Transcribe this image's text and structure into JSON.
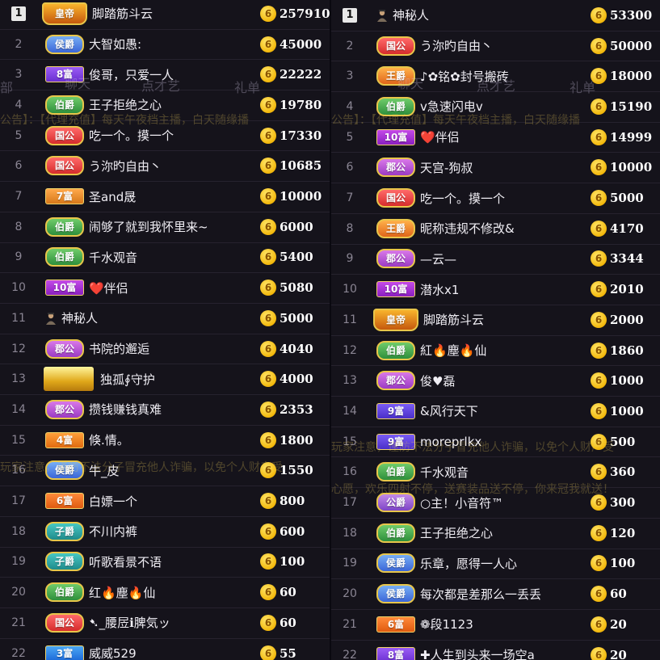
{
  "colors": {
    "background": "#15131b",
    "coin": "#f3b80c",
    "text": "#f0eef4",
    "rank": "#8a8593"
  },
  "icons": {
    "coin": "coin-icon",
    "mystery": "mystery-person-icon",
    "guardian": "guardian-crown-icon"
  },
  "overlay": {
    "tabs": [
      "聊天",
      "点才艺",
      "礼单"
    ],
    "left_edge": "部",
    "announcement_1": "公告】：【代理充值】每天午夜档主播，白天随缘播",
    "announcement_2": "玩家注意，谨防不法分子冒充他人诈骗，以免个人财产受",
    "announcement_3": "心愿，欢乐四射不停，送赛装品送不停，你来冠我就送！"
  },
  "left": [
    {
      "rank": "1",
      "badge": "皇帝",
      "type": "huangdi",
      "name": "脚踏筋斗云",
      "amount": "257910"
    },
    {
      "rank": "2",
      "badge": "侯爵",
      "type": "hou",
      "name": "大智如愚:",
      "amount": "45000"
    },
    {
      "rank": "3",
      "badge": "8富",
      "type": "fu8",
      "name": "俊哥，只爱一人",
      "amount": "22222"
    },
    {
      "rank": "4",
      "badge": "伯爵",
      "type": "bo",
      "name": "王子拒绝之心",
      "amount": "19780"
    },
    {
      "rank": "5",
      "badge": "国公",
      "type": "gong",
      "name": "吃一个。摸一个",
      "amount": "17330"
    },
    {
      "rank": "6",
      "badge": "国公",
      "type": "gong",
      "name": "う沵旳自由丶",
      "amount": "10685"
    },
    {
      "rank": "7",
      "badge": "7富",
      "type": "fu7",
      "name": "圣and晟",
      "amount": "10000"
    },
    {
      "rank": "8",
      "badge": "伯爵",
      "type": "bo",
      "name": "闹够了就到我怀里来~",
      "amount": "6000"
    },
    {
      "rank": "9",
      "badge": "伯爵",
      "type": "bo",
      "name": "千水观音",
      "amount": "5400"
    },
    {
      "rank": "10",
      "badge": "10富",
      "type": "fu10",
      "name": "❤️伴侣",
      "amount": "5080"
    },
    {
      "rank": "11",
      "badge": "",
      "type": "mystery",
      "name": "神秘人",
      "amount": "5000"
    },
    {
      "rank": "12",
      "badge": "郡公",
      "type": "jungong",
      "name": "书院的邂逅",
      "amount": "4040"
    },
    {
      "rank": "13",
      "badge": "",
      "type": "guardian",
      "name": "独孤∮守护",
      "amount": "4000"
    },
    {
      "rank": "14",
      "badge": "郡公",
      "type": "jungong",
      "name": "攒钱赚钱真难",
      "amount": "2353"
    },
    {
      "rank": "15",
      "badge": "4富",
      "type": "fu4",
      "name": "倏.情。",
      "amount": "1800"
    },
    {
      "rank": "16",
      "badge": "侯爵",
      "type": "hou",
      "name": "牛_皮",
      "amount": "1550"
    },
    {
      "rank": "17",
      "badge": "6富",
      "type": "fu6",
      "name": "白嫖一个",
      "amount": "800"
    },
    {
      "rank": "18",
      "badge": "子爵",
      "type": "zi",
      "name": "不川内裤",
      "amount": "600"
    },
    {
      "rank": "19",
      "badge": "子爵",
      "type": "zi",
      "name": "听歌看景不语",
      "amount": "100"
    },
    {
      "rank": "20",
      "badge": "伯爵",
      "type": "bo",
      "name": "红🔥塵🔥仙",
      "amount": "60"
    },
    {
      "rank": "21",
      "badge": "国公",
      "type": "gong",
      "name": "➷_腰㞐ℹ脾気ッ",
      "amount": "60"
    },
    {
      "rank": "22",
      "badge": "3富",
      "type": "fu3",
      "name": "威威529",
      "amount": "55"
    }
  ],
  "right": [
    {
      "rank": "1",
      "badge": "",
      "type": "mystery",
      "name": "神秘人",
      "amount": "53300"
    },
    {
      "rank": "2",
      "badge": "国公",
      "type": "gong",
      "name": "う沵旳自由丶",
      "amount": "50000"
    },
    {
      "rank": "3",
      "badge": "王爵",
      "type": "wang",
      "name": "♪✿铭✿封号搬砖",
      "amount": "18000"
    },
    {
      "rank": "4",
      "badge": "伯爵",
      "type": "bo",
      "name": "v急速闪电v",
      "amount": "15190"
    },
    {
      "rank": "5",
      "badge": "10富",
      "type": "fu10",
      "name": "❤️伴侣",
      "amount": "14999"
    },
    {
      "rank": "6",
      "badge": "郡公",
      "type": "jungong",
      "name": "天宫-狗叔",
      "amount": "10000"
    },
    {
      "rank": "7",
      "badge": "国公",
      "type": "gong",
      "name": "吃一个。摸一个",
      "amount": "5000"
    },
    {
      "rank": "8",
      "badge": "王爵",
      "type": "wang",
      "name": "昵称违规不修改&",
      "amount": "4170"
    },
    {
      "rank": "9",
      "badge": "郡公",
      "type": "jungong",
      "name": "—云—",
      "amount": "3344"
    },
    {
      "rank": "10",
      "badge": "10富",
      "type": "fu10",
      "name": "潜水x1",
      "amount": "2010"
    },
    {
      "rank": "11",
      "badge": "皇帝",
      "type": "huangdi",
      "name": "脚踏筋斗云",
      "amount": "2000"
    },
    {
      "rank": "12",
      "badge": "伯爵",
      "type": "bo",
      "name": "紅🔥塵🔥仙",
      "amount": "1860"
    },
    {
      "rank": "13",
      "badge": "郡公",
      "type": "jungong",
      "name": "俊♥磊",
      "amount": "1000"
    },
    {
      "rank": "14",
      "badge": "9富",
      "type": "fu9",
      "name": "&风行天下",
      "amount": "1000"
    },
    {
      "rank": "15",
      "badge": "9富",
      "type": "fu9",
      "name": "moreprlkx",
      "amount": "500"
    },
    {
      "rank": "16",
      "badge": "伯爵",
      "type": "bo",
      "name": "千水观音",
      "amount": "360"
    },
    {
      "rank": "17",
      "badge": "公爵",
      "type": "gongjue",
      "name": "○主！小音符™",
      "amount": "300"
    },
    {
      "rank": "18",
      "badge": "伯爵",
      "type": "bo",
      "name": "王子拒绝之心",
      "amount": "120"
    },
    {
      "rank": "19",
      "badge": "侯爵",
      "type": "hou",
      "name": "乐章，愿得一人心",
      "amount": "100"
    },
    {
      "rank": "20",
      "badge": "侯爵",
      "type": "hou",
      "name": "每次都是差那么一丢丢",
      "amount": "60"
    },
    {
      "rank": "21",
      "badge": "6富",
      "type": "fu6",
      "name": "❁段1123",
      "amount": "20"
    },
    {
      "rank": "22",
      "badge": "8富",
      "type": "fu8",
      "name": "✚人生到头来一场空a",
      "amount": "20"
    }
  ]
}
